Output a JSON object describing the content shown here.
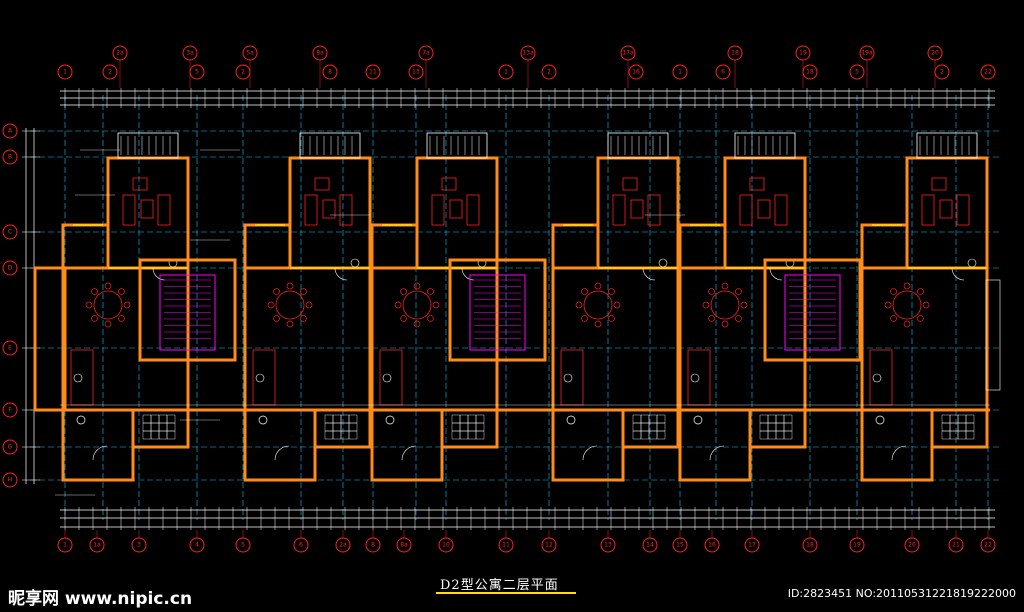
{
  "drawing": {
    "title": "D2型公寓二层平面",
    "watermark_site": "昵享网 www.nipic.cn",
    "watermark_id": "ID:2823451 NO:20110531221819222000"
  },
  "axes": {
    "top_row_1": [
      "2a",
      "3a",
      "5a",
      "8a",
      "7a",
      "13a",
      "17a",
      "18",
      "19",
      "19a",
      "20"
    ],
    "top_row_2": [
      "1",
      "2",
      "5",
      "2",
      "8",
      "11",
      "13",
      "1",
      "2",
      "16",
      "1",
      "6",
      "18",
      "5",
      "2",
      "22"
    ],
    "bottom": [
      "1",
      "1a",
      "3",
      "4",
      "5",
      "6",
      "2a",
      "8",
      "8a",
      "10",
      "11",
      "12",
      "13",
      "14",
      "15",
      "16",
      "17",
      "18",
      "19",
      "20",
      "21",
      "22"
    ],
    "left": [
      "A",
      "B",
      "C",
      "D",
      "E",
      "F",
      "G",
      "H"
    ]
  },
  "colors": {
    "wall": "#ff8c1a",
    "axis": "#00c8ff",
    "furniture": "#ff2020",
    "text": "#ffffff",
    "stair": "#ff00ff",
    "window": "#ffff00",
    "dimension": "#ffffff",
    "grid_green": "#00ff60"
  }
}
